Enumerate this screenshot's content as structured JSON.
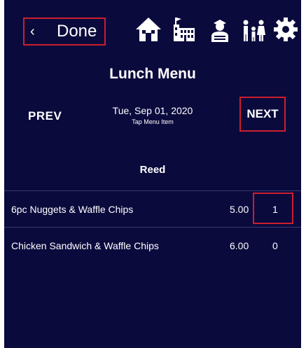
{
  "header": {
    "back_label": "Done",
    "nav_icons": [
      "home-icon",
      "school-icon",
      "student-icon",
      "family-icon",
      "gear-icon"
    ]
  },
  "menu": {
    "title": "Lunch Menu",
    "prev_label": "PREV",
    "date": "Tue, Sep 01, 2020",
    "hint": "Tap Menu Item",
    "next_label": "NEXT",
    "section": "Reed",
    "items": [
      {
        "name": "6pc  Nuggets & Waffle Chips",
        "price": "5.00",
        "qty": "1"
      },
      {
        "name": "Chicken Sandwich & Waffle Chips",
        "price": "6.00",
        "qty": "0"
      }
    ]
  },
  "colors": {
    "background": "#0b0a3d",
    "highlight": "#cc1f2e",
    "text": "#ffffff"
  }
}
